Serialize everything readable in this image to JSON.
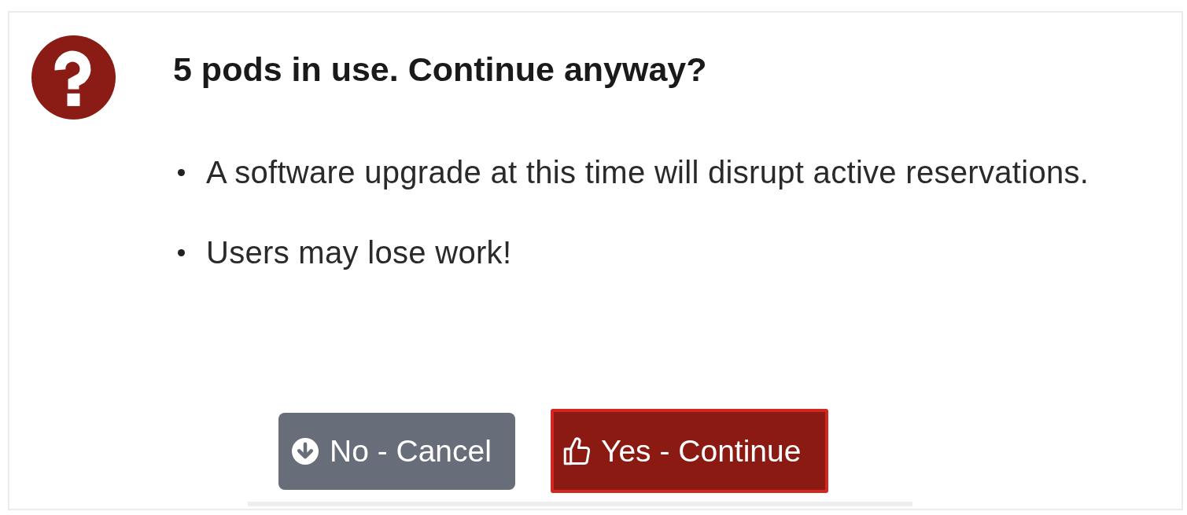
{
  "dialog": {
    "title": "5 pods in use. Continue anyway?",
    "messages": [
      "A software upgrade at this time will disrupt active reservations.",
      "Users may lose work!"
    ],
    "buttons": [
      {
        "label": "No - Cancel",
        "kind": "cancel",
        "focused": false
      },
      {
        "label": "Yes - Continue",
        "kind": "confirm",
        "focused": true
      }
    ]
  }
}
